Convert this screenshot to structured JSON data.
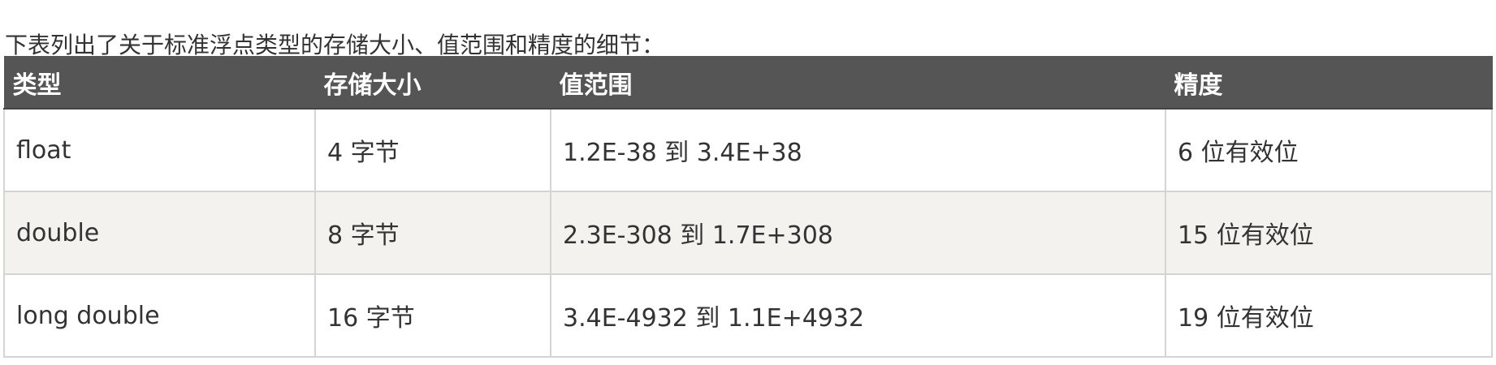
{
  "intro": "下表列出了关于标准浮点类型的存储大小、值范围和精度的细节：",
  "table": {
    "headers": [
      "类型",
      "存储大小",
      "值范围",
      "精度"
    ],
    "rows": [
      [
        "float",
        "4 字节",
        "1.2E-38 到 3.4E+38",
        "6 位有效位"
      ],
      [
        "double",
        "8 字节",
        "2.3E-308 到 1.7E+308",
        "15 位有效位"
      ],
      [
        "long double",
        "16 字节",
        "3.4E-4932 到 1.1E+4932",
        "19 位有效位"
      ]
    ]
  },
  "colors": {
    "header_bg": "#555555",
    "header_text": "#ffffff",
    "alt_row_bg": "#f3f2ee",
    "border": "#d4d4d4",
    "text": "#333333"
  }
}
